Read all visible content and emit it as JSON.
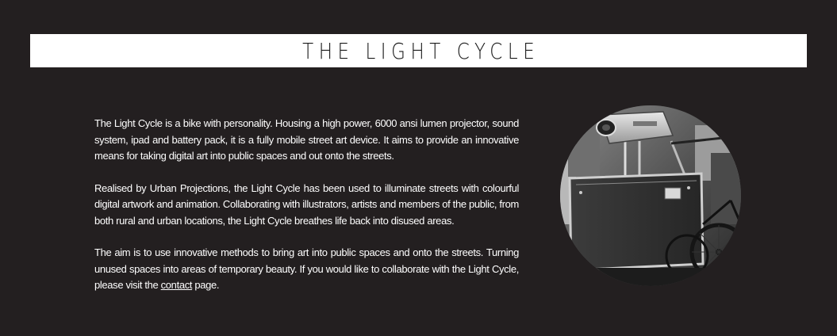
{
  "header": {
    "title": "THE LIGHT CYCLE"
  },
  "intro": {
    "paragraph_1": "The Light Cycle is a bike with personality.  Housing a high power, 6000 ansi lumen projector, sound system, ipad and battery pack, it is a fully mobile street art device.  It aims to provide an innovative means for taking digital art into public spaces and out onto the streets.",
    "paragraph_2": "Realised by Urban Projections, the Light Cycle has been used to illuminate streets with colourful digital artwork and animation.   Collaborating with illustrators, artists and members of the public, from both rural and urban locations, the Light Cycle breathes life back into disused areas.",
    "paragraph_3_before": "The aim is to use innovative methods to bring art into public spaces and onto the streets.  Turning unused spaces into areas of temporary beauty.  If you would like to collaborate with the Light Cycle, please visit the ",
    "contact_link": "contact",
    "paragraph_3_after": " page."
  },
  "colors": {
    "background": "#231f20",
    "title_bar": "#ffffff",
    "text": "#ffffff"
  }
}
